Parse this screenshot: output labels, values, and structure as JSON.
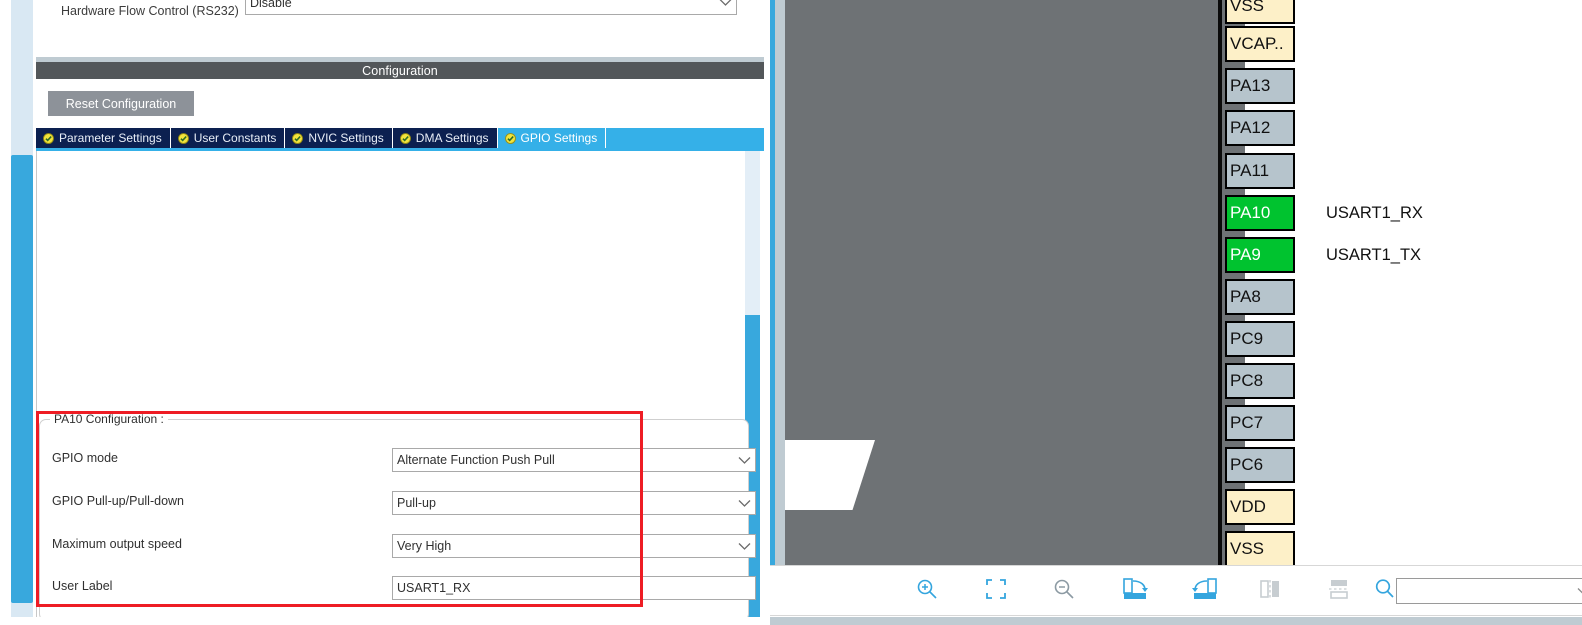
{
  "form": {
    "hardware_flow_control": {
      "label": "Hardware Flow Control (RS232)",
      "value": "Disable"
    }
  },
  "configuration": {
    "header_title": "Configuration",
    "reset_button": "Reset Configuration",
    "tabs": [
      {
        "label": "Parameter Settings",
        "icon": "check-circle-icon",
        "active": false
      },
      {
        "label": "User Constants",
        "icon": "check-circle-icon",
        "active": false
      },
      {
        "label": "NVIC Settings",
        "icon": "check-circle-icon",
        "active": false
      },
      {
        "label": "DMA Settings",
        "icon": "check-circle-icon",
        "active": false
      },
      {
        "label": "GPIO Settings",
        "icon": "check-circle-icon",
        "active": true
      }
    ]
  },
  "pin_config": {
    "group_title": "PA10 Configuration :",
    "fields": [
      {
        "label": "GPIO mode",
        "value": "Alternate Function Push Pull",
        "type": "select"
      },
      {
        "label": "GPIO Pull-up/Pull-down",
        "value": "Pull-up",
        "type": "select"
      },
      {
        "label": "Maximum output speed",
        "value": "Very High",
        "type": "select"
      },
      {
        "label": "User Label",
        "value": "USART1_RX",
        "type": "text"
      }
    ]
  },
  "highlight": {
    "color": "#ee1c24",
    "target": "pa10-configuration-group"
  },
  "chip_view": {
    "pins": [
      {
        "name": "VSS",
        "kind": "power",
        "signal": ""
      },
      {
        "name": "VCAP..",
        "kind": "power",
        "signal": ""
      },
      {
        "name": "PA13",
        "kind": "io",
        "signal": ""
      },
      {
        "name": "PA12",
        "kind": "io",
        "signal": ""
      },
      {
        "name": "PA11",
        "kind": "io",
        "signal": ""
      },
      {
        "name": "PA10",
        "kind": "active",
        "signal": "USART1_RX"
      },
      {
        "name": "PA9",
        "kind": "active",
        "signal": "USART1_TX"
      },
      {
        "name": "PA8",
        "kind": "io",
        "signal": ""
      },
      {
        "name": "PC9",
        "kind": "io",
        "signal": ""
      },
      {
        "name": "PC8",
        "kind": "io",
        "signal": ""
      },
      {
        "name": "PC7",
        "kind": "io",
        "signal": ""
      },
      {
        "name": "PC6",
        "kind": "io",
        "signal": ""
      },
      {
        "name": "VDD",
        "kind": "power",
        "signal": ""
      },
      {
        "name": "VSS",
        "kind": "power",
        "signal": ""
      }
    ],
    "colors": {
      "power": "#fdf0c8",
      "io": "#b6c4cc",
      "active": "#00c32f",
      "chip_body": "#6e7275"
    }
  },
  "toolbar": {
    "buttons": [
      {
        "name": "zoom-in-icon",
        "tooltip": "Zoom In"
      },
      {
        "name": "fit-to-screen-icon",
        "tooltip": "Fit to Screen"
      },
      {
        "name": "zoom-out-icon",
        "tooltip": "Zoom Out"
      },
      {
        "name": "rotate-right-icon",
        "tooltip": "Rotate Right"
      },
      {
        "name": "rotate-left-icon",
        "tooltip": "Rotate Left"
      },
      {
        "name": "flip-horizontal-icon",
        "tooltip": "Flip Horizontal"
      },
      {
        "name": "flip-vertical-icon",
        "tooltip": "Flip Vertical"
      }
    ],
    "search": {
      "icon": "search-icon",
      "value": "",
      "placeholder": ""
    }
  }
}
